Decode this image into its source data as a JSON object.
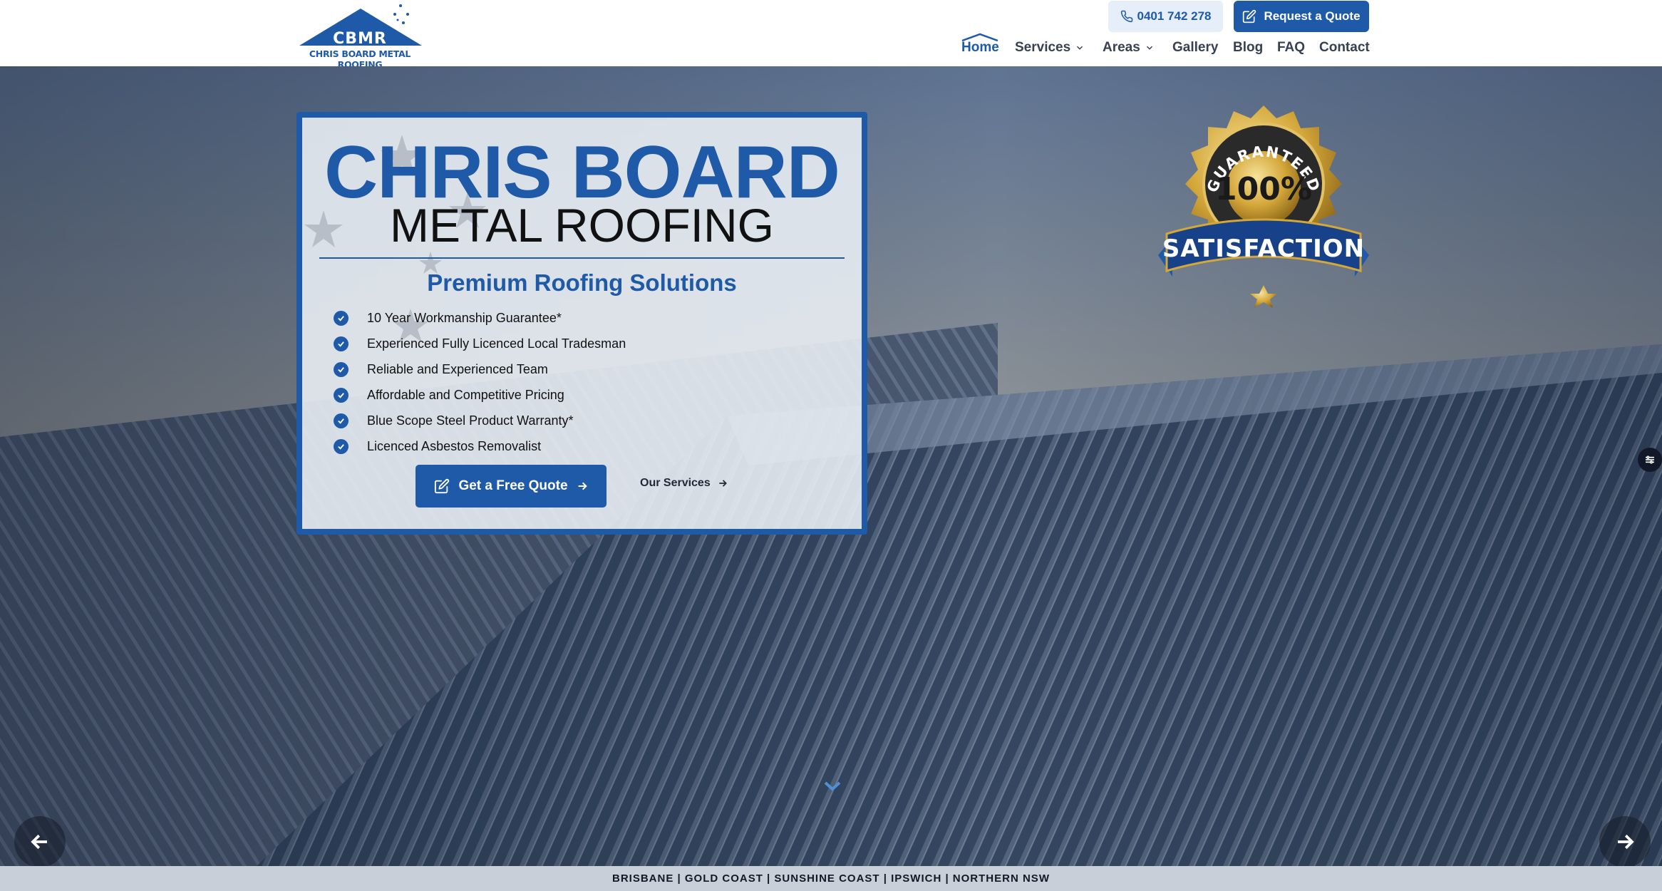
{
  "header": {
    "logo": {
      "abbreviation": "CBMR",
      "name": "CHRIS BOARD METAL ROOFING"
    },
    "phone_label": "0401 742 278",
    "quote_label": "Request a Quote"
  },
  "nav": {
    "items": [
      {
        "label": "Home",
        "active": true,
        "dropdown": false
      },
      {
        "label": "Services",
        "active": false,
        "dropdown": true
      },
      {
        "label": "Areas",
        "active": false,
        "dropdown": true
      },
      {
        "label": "Gallery",
        "active": false,
        "dropdown": false
      },
      {
        "label": "Blog",
        "active": false,
        "dropdown": false
      },
      {
        "label": "FAQ",
        "active": false,
        "dropdown": false
      },
      {
        "label": "Contact",
        "active": false,
        "dropdown": false
      }
    ]
  },
  "hero": {
    "title": "CHRIS BOARD",
    "subtitle": "METAL ROOFING",
    "tagline": "Premium Roofing Solutions",
    "features": [
      "10 Year Workmanship Guarantee*",
      "Experienced Fully Licenced Local Tradesman",
      "Reliable and Experienced Team",
      "Affordable and Competitive Pricing",
      "Blue Scope Steel Product Warranty*",
      "Licenced Asbestos Removalist"
    ],
    "cta_label": "Get a Free Quote",
    "secondary_label": "Our Services",
    "badge": {
      "top_text": "GUARANTEED",
      "value": "100%",
      "banner": "SATISFACTION"
    }
  },
  "footer_strip": "BRISBANE | GOLD COAST | SUNSHINE COAST | IPSWICH | NORTHERN NSW",
  "colors": {
    "brand": "#1e5aa8",
    "gold": "#d4a73a",
    "dark": "#111827"
  }
}
